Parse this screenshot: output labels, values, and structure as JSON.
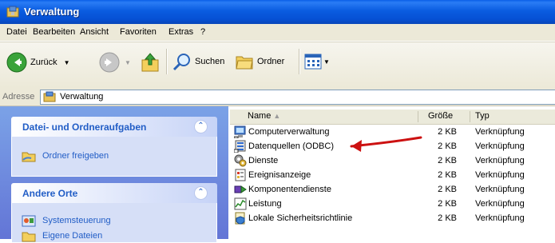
{
  "window": {
    "title": "Verwaltung"
  },
  "menu": [
    "Datei",
    "Bearbeiten",
    "Ansicht",
    "Favoriten",
    "Extras",
    "?"
  ],
  "toolbar": {
    "back_label": "Zurück",
    "search_label": "Suchen",
    "folders_label": "Ordner"
  },
  "address": {
    "label": "Adresse",
    "value": "Verwaltung"
  },
  "tasks": {
    "panel1": {
      "title": "Datei- und Ordneraufgaben",
      "links": [
        "Ordner freigeben"
      ]
    },
    "panel2": {
      "title": "Andere Orte",
      "links": [
        "Systemsteuerung",
        "Eigene Dateien"
      ]
    }
  },
  "columns": {
    "name": "Name",
    "size": "Größe",
    "type": "Typ"
  },
  "files": [
    {
      "name": "Computerverwaltung",
      "size": "2 KB",
      "type": "Verknüpfung",
      "icon": "computer-management-icon"
    },
    {
      "name": "Datenquellen (ODBC)",
      "size": "2 KB",
      "type": "Verknüpfung",
      "icon": "odbc-datasource-icon"
    },
    {
      "name": "Dienste",
      "size": "2 KB",
      "type": "Verknüpfung",
      "icon": "services-icon"
    },
    {
      "name": "Ereignisanzeige",
      "size": "2 KB",
      "type": "Verknüpfung",
      "icon": "event-viewer-icon"
    },
    {
      "name": "Komponentendienste",
      "size": "2 KB",
      "type": "Verknüpfung",
      "icon": "component-services-icon"
    },
    {
      "name": "Leistung",
      "size": "2 KB",
      "type": "Verknüpfung",
      "icon": "performance-icon"
    },
    {
      "name": "Lokale Sicherheitsrichtlinie",
      "size": "2 KB",
      "type": "Verknüpfung",
      "icon": "local-security-policy-icon"
    }
  ],
  "colors": {
    "title_bar": "#0a5ce0",
    "task_pane": "#7ba2e7",
    "annotation_arrow": "#cc1111"
  }
}
